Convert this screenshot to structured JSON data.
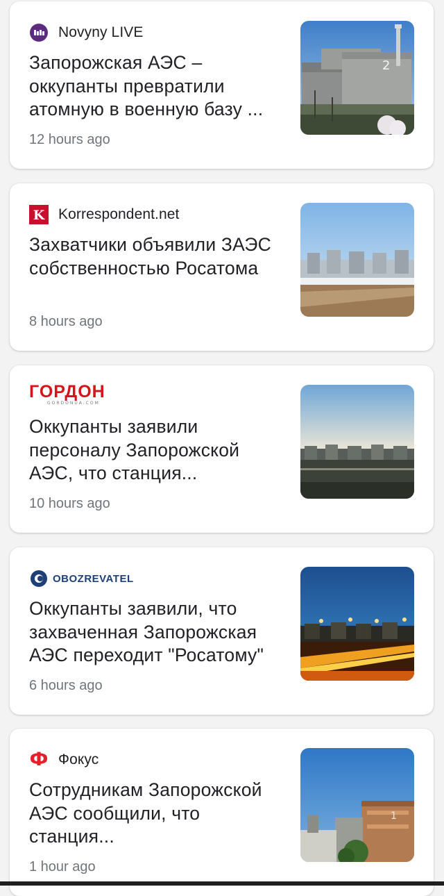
{
  "articles": [
    {
      "source": "Novyny LIVE",
      "logo": "novyny-live-logo",
      "headline": "Запорожская АЭС – оккупанты превратили атомную в военную базу ...",
      "time": "12 hours ago",
      "thumb": "nuclear-plant-building-photo",
      "thumb_label": "2"
    },
    {
      "source": "Korrespondent.net",
      "logo": "korrespondent-logo",
      "logo_letter": "K",
      "headline": "Захватчики объявили ЗАЭС собственностью Росатома",
      "time": "8 hours ago",
      "thumb": "nuclear-plant-winter-photo"
    },
    {
      "source": "",
      "logo": "gordon-logo",
      "logo_text": "ГОРДОН",
      "logo_sub": "GORDONUA.COM",
      "headline": "Оккупанты заявили персоналу Запорожской АЭС, что станция...",
      "time": "10 hours ago",
      "thumb": "nuclear-plant-skyline-photo"
    },
    {
      "source": "",
      "logo": "obozrevatel-logo",
      "logo_text": "OBOZREVATEL",
      "headline": "Оккупанты заявили, что захваченная Запорожская АЭС переходит \"Росатому\"",
      "time": "6 hours ago",
      "thumb": "nuclear-plant-night-photo"
    },
    {
      "source": "Фокус",
      "logo": "fokus-logo",
      "logo_letter": "Ф",
      "headline": "Сотрудникам Запорожской АЭС сообщили, что станция...",
      "time": "1 hour ago",
      "thumb": "nuclear-plant-reactor-photo",
      "thumb_label": "1"
    }
  ],
  "colors": {
    "background": "#f3f3f3",
    "card": "#ffffff",
    "headline": "#202124",
    "time": "#70757a",
    "korrespondent_red": "#c8102e",
    "gordon_red": "#d7141a",
    "obozrevatel_blue": "#1f3f77",
    "novyny_purple": "#5b2b82",
    "fokus_red": "#e3202b"
  }
}
